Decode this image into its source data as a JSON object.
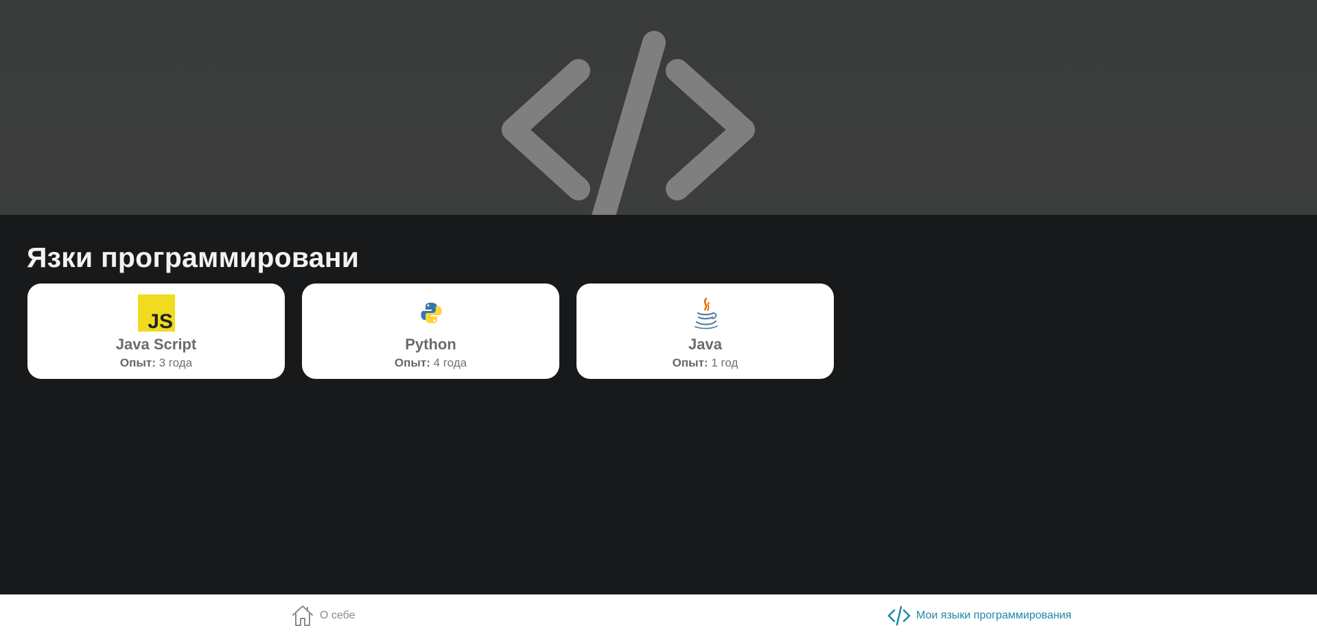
{
  "hero": {
    "icon": "code-brackets-icon"
  },
  "section": {
    "title": "Язки программировани"
  },
  "languages": [
    {
      "name": "Java Script",
      "exp_label": "Опыт:",
      "exp_value": "3 года",
      "icon": "javascript-logo-icon",
      "color": "#f0db1e"
    },
    {
      "name": "Python",
      "exp_label": "Опыт:",
      "exp_value": "4 года",
      "icon": "python-logo-icon",
      "color": "#3776ab"
    },
    {
      "name": "Java",
      "exp_label": "Опыт:",
      "exp_value": "1 год",
      "icon": "java-logo-icon",
      "color": "#e76f00"
    }
  ],
  "nav": {
    "home_label": "О себе",
    "home_icon": "home-icon",
    "langs_label": "Мои языки программирования",
    "langs_icon": "code-icon",
    "active_color": "#1a87a6",
    "inactive_color": "#8a8a8a"
  },
  "colors": {
    "page_bg": "#18191b",
    "hero_bg": "#3b3c3c",
    "hero_icon": "#7f7f7f",
    "card_bg": "#ffffff"
  }
}
